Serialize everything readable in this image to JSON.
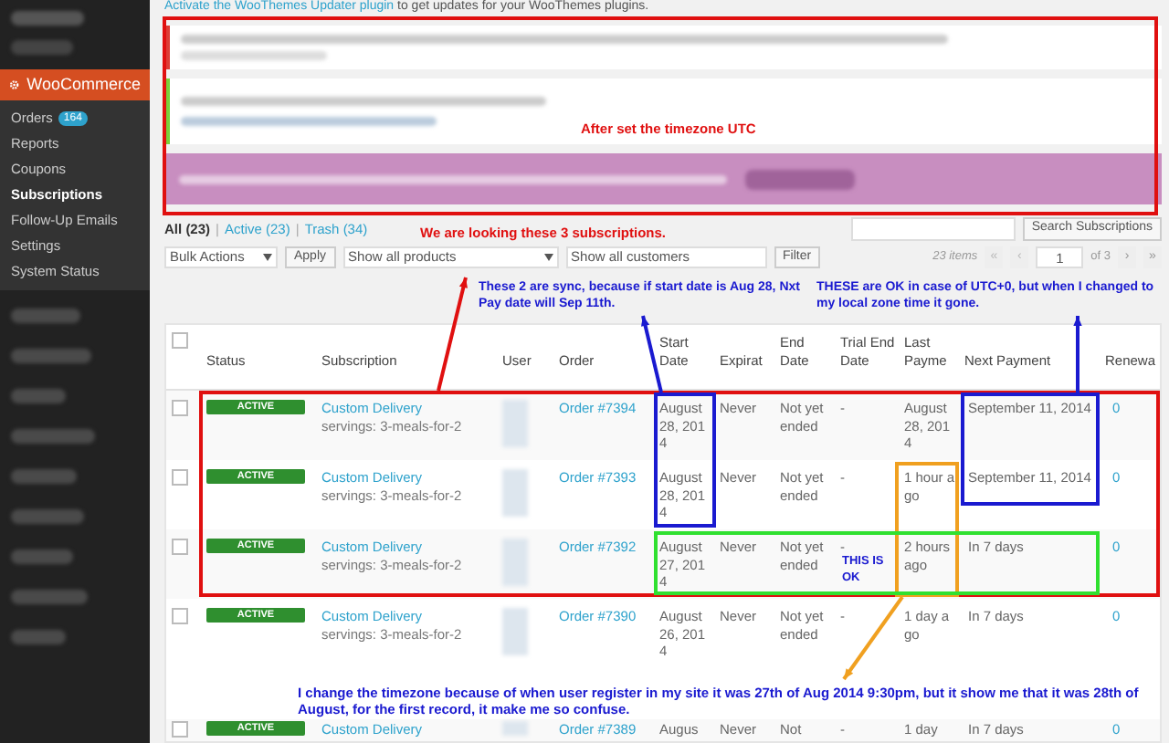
{
  "sidebar": {
    "menu_title": "WooCommerce",
    "menu_selected": true,
    "items": [
      {
        "label": "Orders",
        "badge": "164",
        "selected": false
      },
      {
        "label": "Reports",
        "selected": false
      },
      {
        "label": "Coupons",
        "selected": false
      },
      {
        "label": "Subscriptions",
        "selected": true
      },
      {
        "label": "Follow-Up Emails",
        "selected": false
      },
      {
        "label": "Settings",
        "selected": false
      },
      {
        "label": "System Status",
        "selected": false
      }
    ]
  },
  "notice": {
    "link": "Activate the WooThemes Updater plugin",
    "text": "to get updates for your WooThemes plugins."
  },
  "views": [
    {
      "label": "All",
      "count": "(23)",
      "selected": true
    },
    {
      "separator": "|",
      "label": "Active",
      "count": "(23)",
      "selected": false
    },
    {
      "separator": "|",
      "label": "Trash",
      "count": "(34)",
      "selected": false
    }
  ],
  "search": {
    "button": "Search Subscriptions"
  },
  "toolbar": {
    "bulk_actions": "Bulk Actions",
    "apply": "Apply",
    "products": "Show all products",
    "customers": "Show all customers",
    "filter": "Filter",
    "items": "23 items",
    "first": "«",
    "prev": "‹",
    "page": "1",
    "of": "of 3",
    "next": "›",
    "last": "»"
  },
  "table": {
    "select_all_checked": false,
    "columns": [
      "Status",
      "Subscription",
      "User",
      "Order",
      "Start Date",
      "Expirat",
      "End Date",
      "Trial End Date",
      "Last Payme",
      "Next Payment",
      "Renewa"
    ],
    "rows": [
      {
        "checked": false,
        "status": "ACTIVE",
        "kind": "active",
        "product": "Custom Delivery",
        "variation": "servings: 3-meals-for-2",
        "order": "Order #7394",
        "start": "August 28, 2014",
        "expiration": "Never",
        "end": "Not yet ended",
        "trial": "-",
        "last_payment": "August 28, 2014",
        "next_payment": "September 11, 2014",
        "renewals": "0"
      },
      {
        "checked": false,
        "status": "ACTIVE",
        "kind": "active",
        "product": "Custom Delivery",
        "variation": "servings: 3-meals-for-2",
        "order": "Order #7393",
        "start": "August 28, 2014",
        "expiration": "Never",
        "end": "Not yet ended",
        "trial": "-",
        "last_payment": "1 hour ago",
        "next_payment": "September 11, 2014",
        "renewals": "0"
      },
      {
        "checked": false,
        "status": "ACTIVE",
        "kind": "active",
        "product": "Custom Delivery",
        "variation": "servings: 3-meals-for-2",
        "order": "Order #7392",
        "start": "August 27, 2014",
        "expiration": "Never",
        "end": "Not yet ended",
        "trial": "-",
        "last_payment": "2 hours ago",
        "next_payment": "In 7 days",
        "renewals": "0"
      },
      {
        "checked": false,
        "status": "ACTIVE",
        "kind": "active",
        "product": "Custom Delivery",
        "variation": "servings: 3-meals-for-2",
        "order": "Order #7390",
        "start": "August 26, 2014",
        "expiration": "Never",
        "end": "Not yet ended",
        "trial": "-",
        "last_payment": "1 day ago",
        "next_payment": "In 7 days",
        "renewals": "0"
      },
      {
        "checked": false,
        "status": "ACTIVE",
        "kind": "active",
        "product": "Custom Delivery",
        "order": "Order #7389",
        "start": "Augus",
        "expiration": "Never",
        "end": "Not",
        "trial": "-",
        "last_payment": "1 day",
        "next_payment": "In 7 days",
        "renewals": "0"
      }
    ]
  },
  "notes": [
    {
      "text": "After set the timezone UTC",
      "color": "#e01010"
    },
    {
      "text": "We are looking these 3 subscriptions.",
      "color": "#e01010"
    },
    {
      "text": "These 2 are sync, because if start date is Aug 28, Nxt Pay date will Sep 11th.",
      "color": "#1a1ad0"
    },
    {
      "text": "THESE are OK in case of UTC+0, but when I changed to my local zone time it gone.",
      "color": "#1a1ad0"
    },
    {
      "text": "THIS IS OK",
      "color": "#1a1ad0"
    },
    {
      "text": "I change the timezone because of when user register in my site it was 27th of Aug 2014 9:30pm, but it show me that it was 28th of August, for the first record, it make me so confuse.",
      "color": "#1a1ad0"
    }
  ]
}
